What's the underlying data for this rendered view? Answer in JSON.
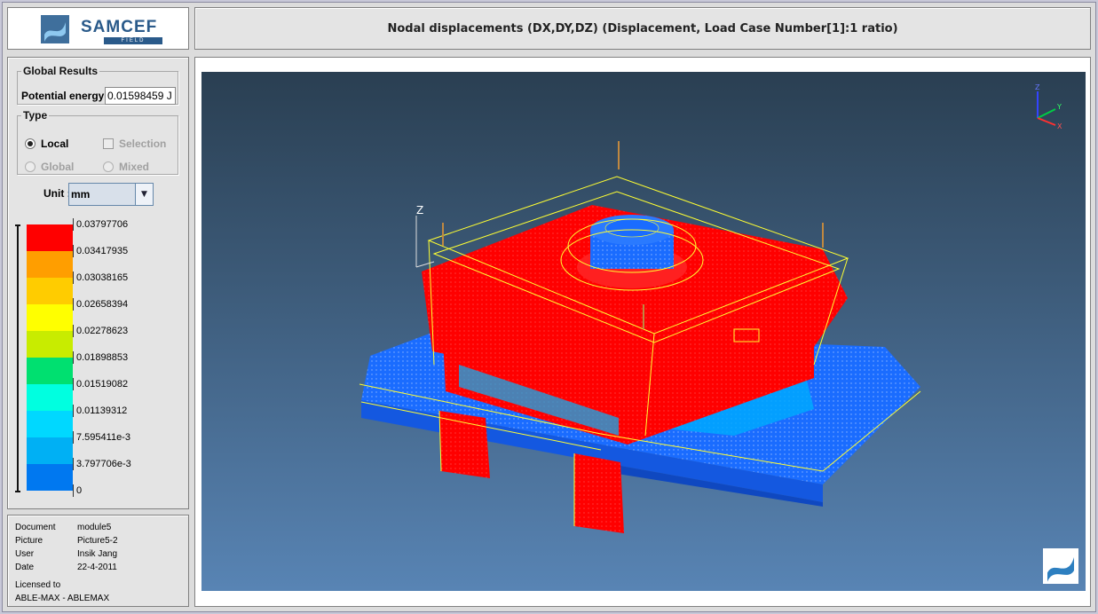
{
  "logo": {
    "brand": "SAMCEF",
    "sub": "FIELD"
  },
  "title": "Nodal displacements (DX,DY,DZ) (Displacement, Load Case Number[1]:1 ratio)",
  "global_results": {
    "legend": "Global Results",
    "potential_energy_label": "Potential energy",
    "potential_energy_value": "0.01598459 J"
  },
  "type_group": {
    "legend": "Type",
    "options": [
      {
        "label": "Local",
        "kind": "radio",
        "selected": true,
        "enabled": true
      },
      {
        "label": "Selection",
        "kind": "checkbox",
        "selected": false,
        "enabled": false
      },
      {
        "label": "Global",
        "kind": "radio",
        "selected": false,
        "enabled": false
      },
      {
        "label": "Mixed",
        "kind": "radio",
        "selected": false,
        "enabled": false
      }
    ]
  },
  "unit": {
    "label": "Unit :",
    "value": "mm"
  },
  "color_scale": {
    "colors": [
      "#ff0000",
      "#ff9e00",
      "#ffcc00",
      "#ffff00",
      "#c8ec00",
      "#00e070",
      "#00ffe0",
      "#00d8ff",
      "#00b0f4",
      "#0078f0"
    ],
    "labels": [
      "0.03797706",
      "0.03417935",
      "0.03038165",
      "0.02658394",
      "0.02278623",
      "0.01898853",
      "0.01519082",
      "0.01139312",
      "7.595411e-3",
      "3.797706e-3",
      "0"
    ]
  },
  "info": {
    "rows": [
      {
        "key": "Document",
        "value": "module5"
      },
      {
        "key": "Picture",
        "value": "Picture5-2"
      },
      {
        "key": "User",
        "value": "Insik Jang"
      },
      {
        "key": "Date",
        "value": "22-4-2011"
      }
    ],
    "licensed_to_label": "Licensed to",
    "licensed_to_value": "ABLE-MAX - ABLEMAX"
  },
  "axes": {
    "z": "Z",
    "triad_x": "X",
    "triad_y": "Y",
    "triad_z": "Z"
  },
  "colors": {
    "hot": "#ff0000",
    "cold": "#1a6cff",
    "wire": "#ffff33",
    "accent": "#2a5a8a"
  }
}
